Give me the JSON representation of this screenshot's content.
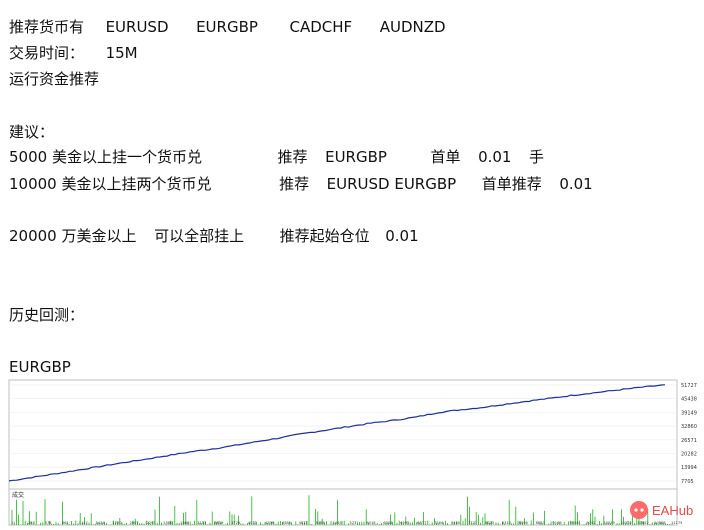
{
  "doc": {
    "line1": {
      "label": "推荐货币有",
      "pairs": [
        "EURUSD",
        "EURGBP",
        "CADCHF",
        "AUDNZD"
      ]
    },
    "line2": {
      "label": "交易时间：",
      "value": "15M"
    },
    "line3": "运行资金推荐",
    "line4": "建议：",
    "line5": {
      "a": "5000 美金以上挂一个货币兑",
      "b": "推荐",
      "c": "EURGBP",
      "d": "首单",
      "e": "0.01",
      "f": "手"
    },
    "line6": {
      "a": "10000 美金以上挂两个货币兑",
      "b": "推荐",
      "c": "EURUSD EURGBP",
      "d": "首单推荐",
      "e": "0.01"
    },
    "line7": {
      "a": "20000 万美金以上",
      "b": "可以全部挂上",
      "c": "推荐起始仓位",
      "d": "0.01"
    },
    "line8": "历史回测：",
    "line9": "EURGBP"
  },
  "chart_data": {
    "type": "line",
    "title": "",
    "ylabels": [
      "51727",
      "45438",
      "39149",
      "32860",
      "26571",
      "20282",
      "13994",
      "7705"
    ],
    "volume_label": "成交",
    "series": [
      {
        "values": [
          7705,
          9300,
          10900,
          12600,
          14300,
          16000,
          17600,
          19300,
          21000,
          22400,
          24000,
          25800,
          27500,
          29400,
          31000,
          32600,
          34200,
          35500,
          37000,
          39100,
          40400,
          41500,
          43000,
          44400,
          45700,
          47100,
          48300,
          49500,
          50700,
          51800
        ]
      }
    ],
    "xlabels": [
      "1",
      "287",
      "574",
      "861",
      "1147",
      "1434",
      "1720",
      "2007",
      "2293",
      "2580",
      "2866",
      "3153",
      "3439",
      "3726",
      "4012",
      "4299",
      "4585",
      "4872",
      "5158",
      "5445",
      "5731",
      "6018",
      "6304",
      "6591",
      "6877",
      "7164",
      "7450",
      "7737",
      "8023",
      "8310",
      "8596",
      "8883",
      "9169",
      "9456",
      "9742",
      "10029",
      "10315",
      "10602",
      "10888",
      "11175"
    ],
    "ylim": [
      4000,
      54000
    ],
    "line_color": "#1f2f9a",
    "volume_color": "#1db31d"
  },
  "watermark": {
    "text": "EAHub"
  }
}
